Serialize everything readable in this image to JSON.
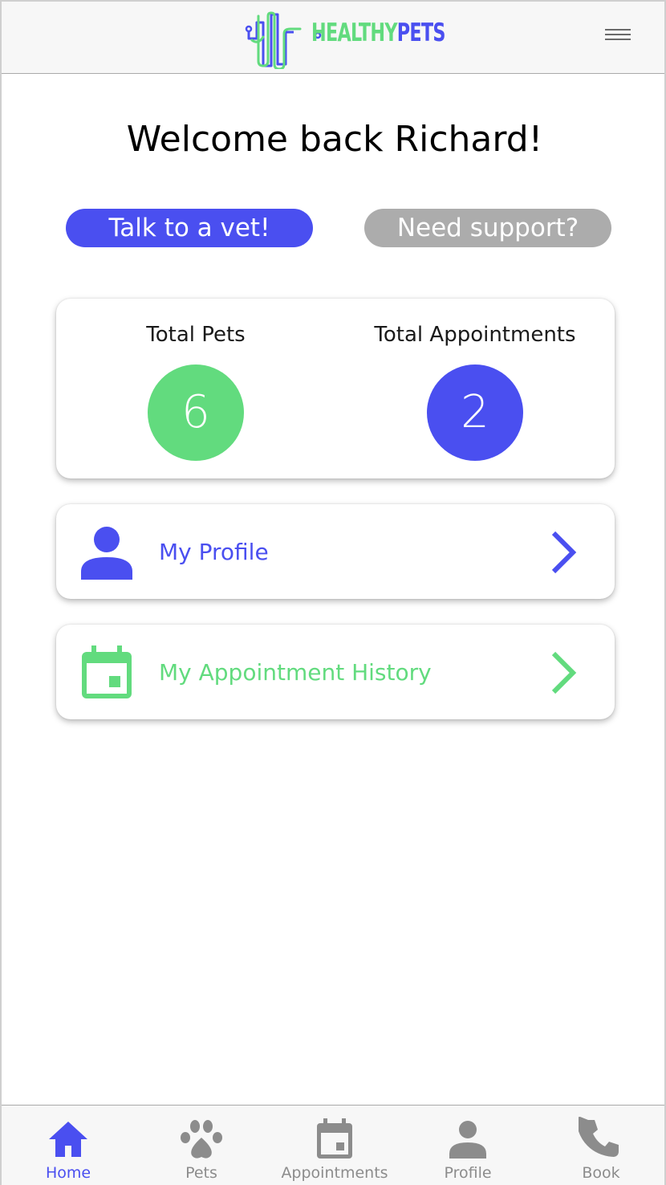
{
  "header": {
    "logo_text_part1": "HEALTHY",
    "logo_text_part2": "PETS",
    "menu_icon": "hamburger-menu-icon"
  },
  "welcome": "Welcome back Richard!",
  "actions": {
    "talk_to_vet": "Talk to a vet!",
    "need_support": "Need support?"
  },
  "stats": {
    "pets_label": "Total Pets",
    "pets_value": "6",
    "appointments_label": "Total Appointments",
    "appointments_value": "2"
  },
  "links": {
    "profile_label": "My Profile",
    "history_label": "My Appointment History"
  },
  "nav": [
    {
      "label": "Home",
      "icon": "home-icon",
      "active": true
    },
    {
      "label": "Pets",
      "icon": "paw-icon",
      "active": false
    },
    {
      "label": "Appointments",
      "icon": "calendar-icon",
      "active": false
    },
    {
      "label": "Profile",
      "icon": "person-icon",
      "active": false
    },
    {
      "label": "Book",
      "icon": "phone-icon",
      "active": false
    }
  ],
  "colors": {
    "primary_blue": "#4a4ff0",
    "accent_green": "#62db7e",
    "support_gray": "#acacac",
    "inactive_gray": "#8c8c8c"
  }
}
